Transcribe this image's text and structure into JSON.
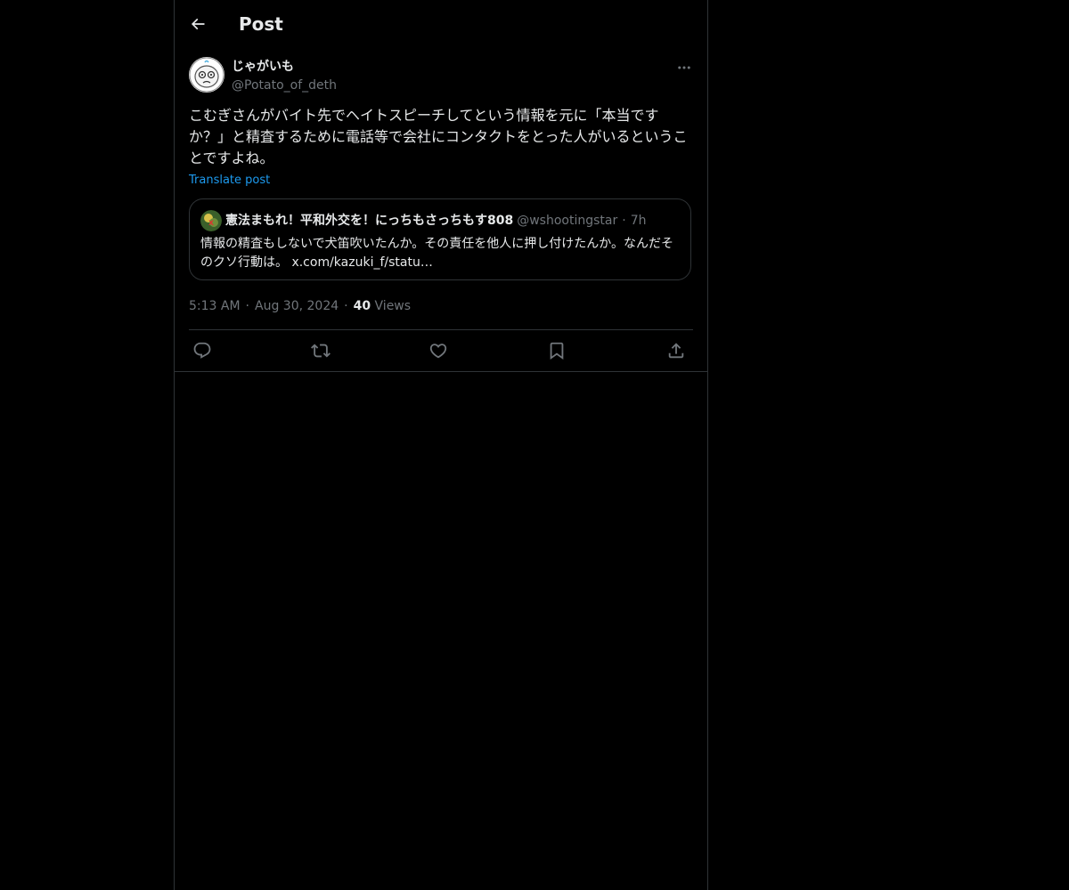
{
  "header": {
    "back_icon": "arrow-left-icon",
    "title": "Post"
  },
  "post": {
    "author": {
      "name": "じゃがいも",
      "handle": "@Potato_of_deth"
    },
    "text": "こむぎさんがバイト先でヘイトスピーチしてという情報を元に「本当ですか？」と精査するために電話等で会社にコンタクトをとった人がいるということですよね。",
    "translate_label": "Translate post",
    "quote": {
      "name": "憲法まもれ！平和外交を！にっちもさっちもす808",
      "handle": "@wshootingstar",
      "separator": "·",
      "time": "7h",
      "text": "情報の精査もしないで犬笛吹いたんか。その責任を他人に押し付けたんか。なんだそのクソ行動は。 x.com/kazuki_f/statu…"
    },
    "meta": {
      "time": "5:13 AM",
      "date": "Aug 30, 2024",
      "separator": "·",
      "views_count": "40",
      "views_label": "Views"
    },
    "actions": [
      "reply-icon",
      "repost-icon",
      "like-icon",
      "bookmark-icon",
      "share-icon"
    ]
  },
  "colors": {
    "background": "#000000",
    "text_primary": "#e7e9ea",
    "text_secondary": "#71767b",
    "link": "#1d9bf0",
    "border": "#2f3336"
  }
}
